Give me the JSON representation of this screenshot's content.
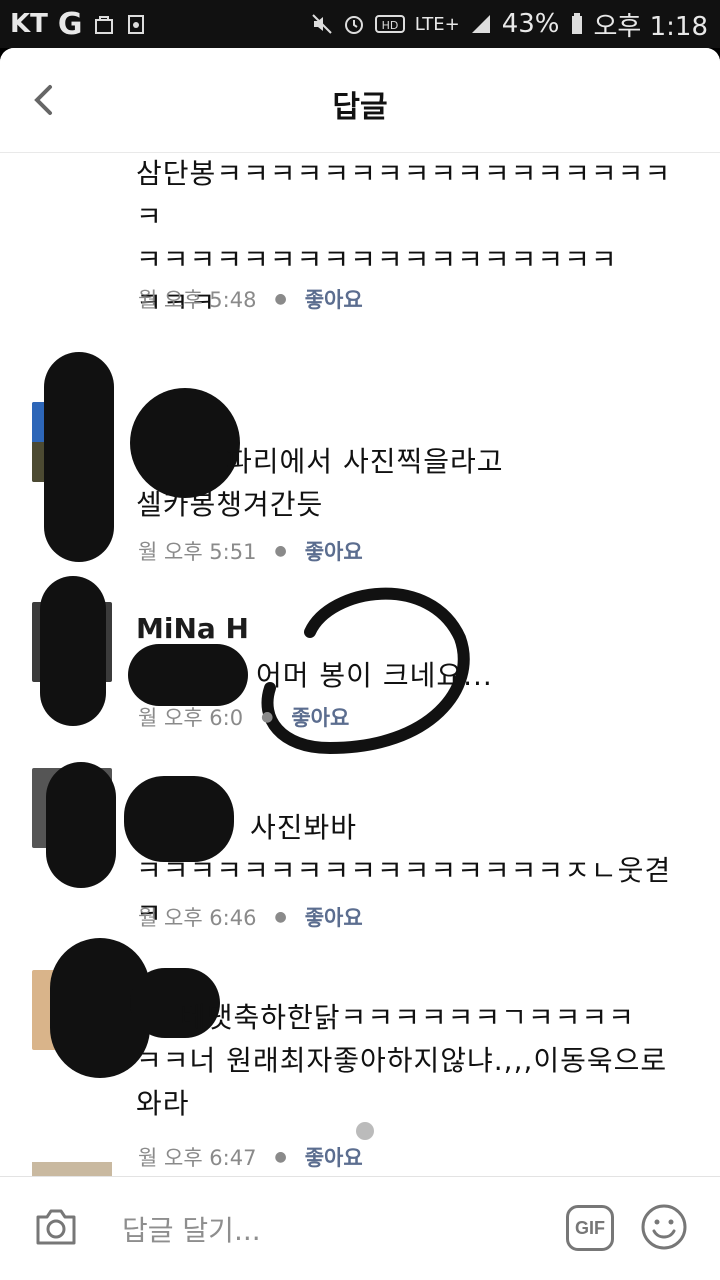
{
  "status_bar": {
    "carrier": "KT",
    "network_g": "G",
    "network_type": "LTE+",
    "battery": "43%",
    "time": "오후 1:18"
  },
  "header": {
    "title": "답글"
  },
  "comments": [
    {
      "text": "삼단봉ㅋㅋㅋㅋㅋㅋㅋㅋㅋㅋㅋㅋㅋㅋㅋㅋㅋㅋ\nㅋㅋㅋㅋㅋㅋㅋㅋㅋㅋㅋㅋㅋㅋㅋㅋㅋㅋ\nㅋㅋㅋ",
      "time": "월 오후 5:48",
      "like": "좋아요"
    },
    {
      "text": "파리에서 사진찍을라고\n셀카봉챙겨간듯",
      "time": "월 오후 5:51",
      "like": "좋아요"
    },
    {
      "name": "MiNa H",
      "text": "어머 봉이 크네요...",
      "time": "월 오후 6:0",
      "like": "좋아요"
    },
    {
      "text": "사진봐바\nㅋㅋㅋㅋㅋㅋㅋㅋㅋㅋㅋㅋㅋㅋㅋㅋㅈㄴ웃겯ㅋ",
      "time": "월 오후 6:46",
      "like": "좋아요"
    },
    {
      "text": "베댓축하한닭ㅋㅋㅋㅋㅋㅋㄱㅋㅋㅋㅋ\nㅋㅋ너 원래최자좋아하지않냐.,,,이동욱으로\n와라",
      "time": "월 오후 6:47",
      "like": "좋아요"
    }
  ],
  "footer": {
    "reply_placeholder": "답글 달기...",
    "gif_label": "GIF"
  },
  "icons": {
    "back": "chevron-left-icon",
    "camera": "camera-icon",
    "emoji": "smiley-icon"
  }
}
